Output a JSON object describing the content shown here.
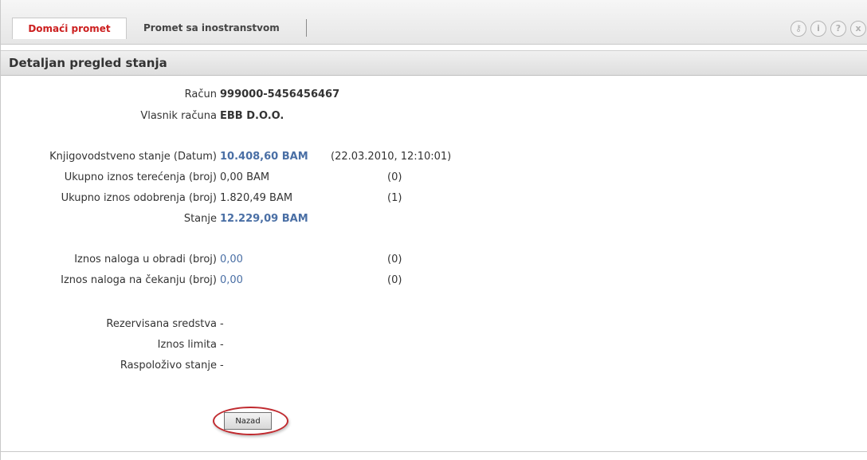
{
  "tabs": {
    "active": "Domaći promet",
    "inactive": "Promet sa inostranstvom"
  },
  "toolbar_icons": [
    "key-icon",
    "info-icon",
    "help-icon",
    "close-icon"
  ],
  "toolbar_glyphs": {
    "key": "⚷",
    "info": "i",
    "help": "?",
    "close": "x"
  },
  "header": {
    "title": "Detaljan pregled stanja"
  },
  "account": {
    "label": "Račun",
    "number": "999000-5456456467",
    "owner_label": "Vlasnik računa",
    "owner": "EBB D.O.O."
  },
  "balance": {
    "book_label": "Knjigovodstveno stanje (Datum)",
    "book_value": "10.408,60 BAM",
    "book_date": "(22.03.2010, 12:10:01)",
    "debit_label": "Ukupno iznos terećenja (broj)",
    "debit_value": "0,00 BAM",
    "debit_count": "(0)",
    "credit_label": "Ukupno iznos odobrenja (broj)",
    "credit_value": "1.820,49 BAM",
    "credit_count": "(1)",
    "state_label": "Stanje",
    "state_value": "12.229,09 BAM"
  },
  "orders": {
    "processing_label": "Iznos naloga u obradi (broj)",
    "processing_value": "0,00",
    "processing_count": "(0)",
    "pending_label": "Iznos naloga na čekanju (broj)",
    "pending_value": "0,00",
    "pending_count": "(0)"
  },
  "funds": {
    "reserved_label": "Rezervisana sredstva",
    "reserved_value": "-",
    "limit_label": "Iznos limita",
    "limit_value": "-",
    "available_label": "Raspoloživo stanje",
    "available_value": "-"
  },
  "actions": {
    "back_label": "Nazad"
  },
  "colors": {
    "accent_red": "#cc1f1f",
    "value_blue": "#4a6fa5",
    "highlight_ring": "#c0292e"
  }
}
